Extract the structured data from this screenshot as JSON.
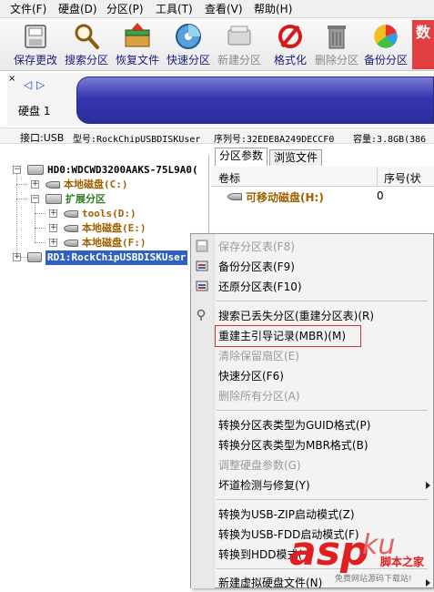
{
  "menubar": {
    "items": [
      "文件(F)",
      "硬盘(D)",
      "分区(P)",
      "工具(T)",
      "查看(V)",
      "帮助(H)"
    ]
  },
  "toolbar": {
    "buttons": [
      {
        "label": "保存更改",
        "icon": "save-disk-icon",
        "enabled": true
      },
      {
        "label": "搜索分区",
        "icon": "magnifier-icon",
        "enabled": true
      },
      {
        "label": "恢复文件",
        "icon": "recover-file-icon",
        "enabled": true
      },
      {
        "label": "快速分区",
        "icon": "quick-partition-icon",
        "enabled": true
      },
      {
        "label": "新建分区",
        "icon": "new-partition-icon",
        "enabled": false
      },
      {
        "label": "格式化",
        "icon": "format-icon",
        "enabled": true
      },
      {
        "label": "删除分区",
        "icon": "trash-icon",
        "enabled": false
      },
      {
        "label": "备份分区",
        "icon": "backup-pie-icon",
        "enabled": true
      }
    ],
    "overflow_glyph": "数"
  },
  "diskstrip": {
    "disk_label": "硬盘 1",
    "nav_left": "◁",
    "nav_right": "▷",
    "close_glyph": "×"
  },
  "infoline": {
    "interface": "接口:USB",
    "model": "型号:RockChipUSBDISKUser",
    "serial": "序列号:32EDE8A249DECCF0",
    "capacity": "容量:3.8GB(386"
  },
  "tree": {
    "nodes": [
      {
        "label": "HD0:WDCWD3200AAKS-75L9A0(",
        "color": "#000000"
      },
      {
        "label": "本地磁盘(C:)",
        "color": "#a06000"
      },
      {
        "label": "扩展分区",
        "color": "#2e7d1e"
      },
      {
        "label": "tools(D:)",
        "color": "#a06000"
      },
      {
        "label": "本地磁盘(E:)",
        "color": "#a06000"
      },
      {
        "label": "本地磁盘(F:)",
        "color": "#a06000"
      },
      {
        "label": "RD1:RockChipUSBDISKUser",
        "color": "#ffffff"
      }
    ]
  },
  "rightpanel": {
    "tabs": [
      "分区参数",
      "浏览文件"
    ],
    "columns": [
      "卷标",
      "序号(状态)"
    ],
    "row": {
      "name": "可移动磁盘(H:)",
      "index": "0"
    }
  },
  "context_menu": {
    "items": [
      {
        "label": "保存分区表(F8)",
        "enabled": false
      },
      {
        "label": "备份分区表(F9)",
        "enabled": true
      },
      {
        "label": "还原分区表(F10)",
        "enabled": true
      },
      {
        "label": "搜索已丢失分区(重建分区表)(R)",
        "enabled": true
      },
      {
        "label": "重建主引导记录(MBR)(M)",
        "enabled": true,
        "highlighted": true
      },
      {
        "label": "清除保留扇区(E)",
        "enabled": false
      },
      {
        "label": "快速分区(F6)",
        "enabled": true
      },
      {
        "label": "删除所有分区(A)",
        "enabled": false
      },
      {
        "label": "转换分区表类型为GUID格式(P)",
        "enabled": true
      },
      {
        "label": "转换分区表类型为MBR格式(B)",
        "enabled": true
      },
      {
        "label": "调整硬盘参数(G)",
        "enabled": false
      },
      {
        "label": "坏道检测与修复(Y)",
        "enabled": true
      },
      {
        "label": "转换为USB-ZIP启动模式(Z)",
        "enabled": true
      },
      {
        "label": "转换为USB-FDD启动模式(F)",
        "enabled": true
      },
      {
        "label": "转换到HDD模式(",
        "enabled": true
      },
      {
        "label": "新建虚拟硬盘文件(N)",
        "enabled": true
      }
    ]
  },
  "watermark": {
    "brand": "asp",
    "brand2": "ku",
    "cn": "脚本之家",
    "tagline": "免费网站源码下载站!"
  },
  "colors": {
    "highlight_border": "#d63030",
    "selection_bg": "#3060c0",
    "watermark_red": "#e02020"
  }
}
